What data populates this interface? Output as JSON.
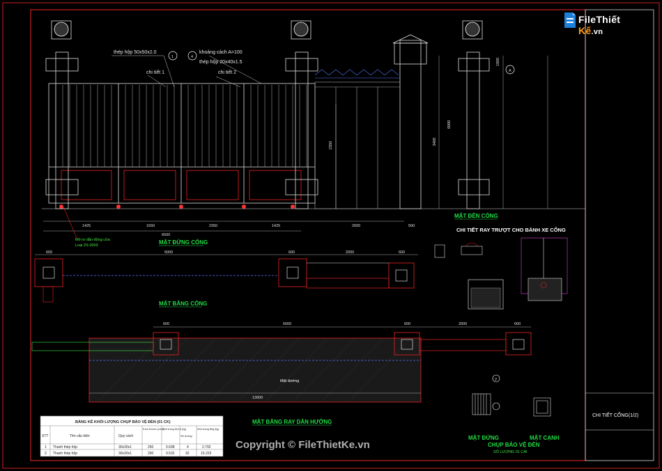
{
  "logo": {
    "text_a": "File",
    "text_b": "Thiết",
    "text_c": "Kế",
    "text_d": ".vn"
  },
  "copyright": "Copyright © FileThietKe.vn",
  "title_block": {
    "title": "CHI TIẾT CỔNG(1/2)"
  },
  "views": {
    "elevation": "MẶT ĐỨNG CỔNG",
    "side_elevation": "MẶT ĐỀN CỔNG",
    "plan": "MẶT BẰNG CỔNG",
    "rail_detail": "CHI TIẾT RAY TRƯỢT CHO BÁNH XE CỔNG",
    "rail_plan": "MẶT BẰNG RAY DẪN HƯỚNG",
    "front": "MẶT ĐỨNG",
    "side": "MẶT CẠNH",
    "lamp_cover": "CHỤP BẢO VỆ ĐÈN",
    "lamp_scale": "SỐ LƯỢNG 01 CÁI",
    "concrete": "Mặt đường"
  },
  "notes": {
    "n1": "thép hộp 50x50x2.0",
    "n4a": "khoảng cách A=100",
    "n4b": "thép hộp 20x40x1.5",
    "detail1": "chi tiết 1",
    "detail2": "chi tiết 2",
    "rail_note": "Mô tơ dẫn động cửa",
    "rail_note2": "Loại 2S-2003"
  },
  "callouts": {
    "c1": "1",
    "c4": "4",
    "cA": "A",
    "c2": "2"
  },
  "dims": {
    "d1": "1425",
    "d2": "1550",
    "d3": "2350",
    "d4": "1425",
    "d5": "2000",
    "d6": "500",
    "total": "6500",
    "h1": "2350",
    "h2": "3400",
    "h3": "6000",
    "h4": "1800",
    "p1": "600",
    "p2": "5000",
    "p3": "600",
    "p4": "2000",
    "p5": "600",
    "r1": "600",
    "r2": "5000",
    "r3": "600",
    "r4": "2000",
    "r5": "600",
    "rlen": "13000"
  },
  "table": {
    "title": "BẢNG KÊ KHỐI LƯỢNG CHỤP BẢO VỆ ĐÈN (01 CK)",
    "headers": [
      "STT",
      "Tên cấu kiện",
      "Quy cách",
      "Kích thước (mm)",
      "Khối lượng đơn vị (kg)",
      "Số lượng",
      "Khối lượng tổng (kg)"
    ],
    "rows": [
      [
        "1",
        "Thanh thép hộp",
        "30x30x1",
        "250",
        "0.698",
        "4",
        "2.792"
      ],
      [
        "2",
        "Thanh thép hộp",
        "30x30x1",
        "290",
        "0.532",
        "32",
        "15.223"
      ]
    ]
  }
}
